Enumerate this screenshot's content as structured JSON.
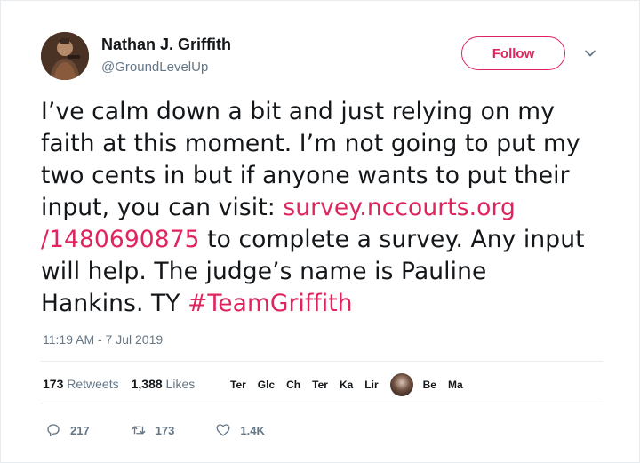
{
  "author": {
    "display_name": "Nathan J. Griffith",
    "handle": "@GroundLevelUp",
    "avatar_icon": "profile-photo"
  },
  "follow_button": {
    "label": "Follow"
  },
  "menu": {
    "icon": "chevron-down-icon"
  },
  "tweet": {
    "lines": [
      "I’ve calm down a bit and just relying on my",
      "faith at this moment. I’m not going to put my",
      "two cents in but if anyone wants to put their"
    ],
    "line4_prefix": "input, you can visit: ",
    "link_part1": "survey.nccourts.org",
    "link_part2": "/1480690875",
    "line5_suffix": " to complete a survey. Any input",
    "line6": "will help. The judge’s name is Pauline",
    "line7_prefix": "Hankins. TY ",
    "hashtag": "#TeamGriffith"
  },
  "timestamp": "11:19 AM - 7 Jul 2019",
  "stats": {
    "retweets_count": "173",
    "retweets_label": "Retweets",
    "likes_count": "1,388",
    "likes_label": "Likes"
  },
  "likers": [
    "Ter",
    "Glc",
    "Ch",
    "Ter",
    "Ka",
    "Lir",
    "Be",
    "Ma"
  ],
  "actions": {
    "replies": "217",
    "retweets": "173",
    "likes": "1.4K"
  },
  "colors": {
    "accent": "#e0245e",
    "text": "#14171a",
    "muted": "#657786",
    "border": "#e6ecf0"
  }
}
